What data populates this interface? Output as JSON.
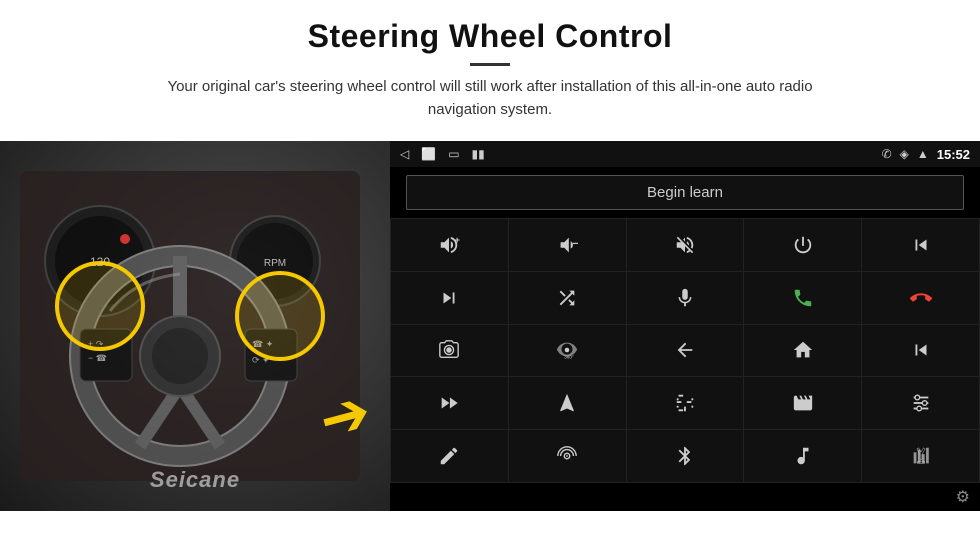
{
  "header": {
    "title": "Steering Wheel Control",
    "divider": true,
    "subtitle": "Your original car's steering wheel control will still work after installation of this all-in-one auto radio navigation system."
  },
  "android_ui": {
    "status_bar": {
      "back_icon": "◁",
      "home_icon": "⬜",
      "square_icon": "▭",
      "signal_icon": "▮▮",
      "phone_icon": "✆",
      "location_icon": "◈",
      "wifi_icon": "▲",
      "time": "15:52"
    },
    "begin_learn_label": "Begin learn",
    "controls": [
      {
        "icon": "vol_up",
        "symbol": "🔊+"
      },
      {
        "icon": "vol_down",
        "symbol": "🔉−"
      },
      {
        "icon": "mute",
        "symbol": "🔇"
      },
      {
        "icon": "power",
        "symbol": "⏻"
      },
      {
        "icon": "prev_track",
        "symbol": "⏮"
      },
      {
        "icon": "skip_fwd",
        "symbol": "⏭"
      },
      {
        "icon": "shuffle",
        "symbol": "⇌⏭"
      },
      {
        "icon": "mic",
        "symbol": "🎤"
      },
      {
        "icon": "phone",
        "symbol": "📞"
      },
      {
        "icon": "hang_up",
        "symbol": "📵"
      },
      {
        "icon": "camera",
        "symbol": "📷"
      },
      {
        "icon": "view360",
        "symbol": "👁360"
      },
      {
        "icon": "back",
        "symbol": "↩"
      },
      {
        "icon": "home",
        "symbol": "⌂"
      },
      {
        "icon": "skip_prev",
        "symbol": "⏮"
      },
      {
        "icon": "skip_next_2",
        "symbol": "⏭"
      },
      {
        "icon": "navigation",
        "symbol": "▶"
      },
      {
        "icon": "equalizer",
        "symbol": "⇌"
      },
      {
        "icon": "media",
        "symbol": "📹"
      },
      {
        "icon": "sliders",
        "symbol": "⧉"
      },
      {
        "icon": "pen",
        "symbol": "✏"
      },
      {
        "icon": "radio",
        "symbol": "⊙"
      },
      {
        "icon": "bluetooth",
        "symbol": "⚡"
      },
      {
        "icon": "music",
        "symbol": "♫"
      },
      {
        "icon": "equalizer2",
        "symbol": "▮▮▮"
      }
    ],
    "bottom": {
      "gear_icon": "⚙"
    }
  },
  "seicane_watermark": "Seicane"
}
